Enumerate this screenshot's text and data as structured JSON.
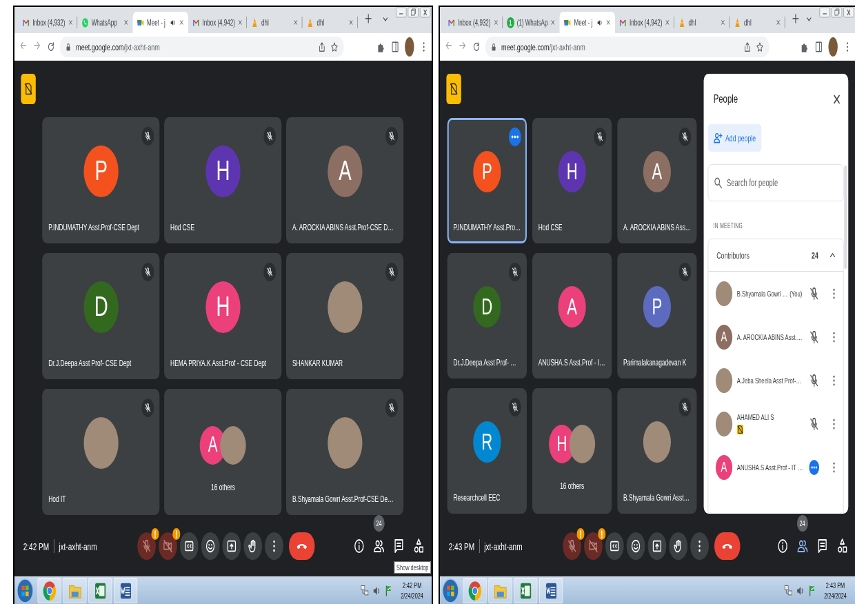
{
  "screens": [
    {
      "browser": {
        "tabs": [
          {
            "kind": "gmail",
            "label": "Inbox (4,932)",
            "selected": false,
            "audio": false
          },
          {
            "kind": "whatsapp",
            "label": "WhatsApp",
            "selected": false,
            "audio": false
          },
          {
            "kind": "meet",
            "label": "Meet - j",
            "selected": true,
            "audio": true
          },
          {
            "kind": "gmail",
            "label": "Inbox (4,942)",
            "selected": false,
            "audio": false
          },
          {
            "kind": "cone",
            "label": "dhl",
            "selected": false,
            "audio": false
          },
          {
            "kind": "cone",
            "label": "dhl",
            "selected": false,
            "audio": false
          }
        ],
        "url_host": "meet.google.com",
        "url_path": "/jxt-axht-anm"
      },
      "meet": {
        "tiles": [
          {
            "kind": "person",
            "name": "P.INDUMATHY Asst.Prof-CSE Dept",
            "avatar": {
              "kind": "initial",
              "initial": "P",
              "color": "#f4511e"
            },
            "muted": true,
            "talking": false,
            "highlighted": false
          },
          {
            "kind": "person",
            "name": "Hod CSE",
            "avatar": {
              "kind": "initial",
              "initial": "H",
              "color": "#5e35b1"
            },
            "muted": true,
            "talking": false,
            "highlighted": false
          },
          {
            "kind": "person",
            "name": "A. AROCKIA ABINS Asst.Prof-CSE D…",
            "avatar": {
              "kind": "initial",
              "initial": "A",
              "color": "#8d6e63"
            },
            "muted": true,
            "talking": false,
            "highlighted": false
          },
          {
            "kind": "person",
            "name": "Dr.J.Deepa Asst Prof- CSE Dept",
            "avatar": {
              "kind": "initial",
              "initial": "D",
              "color": "#33691e"
            },
            "muted": true,
            "talking": false,
            "highlighted": false
          },
          {
            "kind": "person",
            "name": "HEMA PRIYA.K Asst.Prof - CSE Dept",
            "avatar": {
              "kind": "initial",
              "initial": "H",
              "color": "#ec407a"
            },
            "muted": true,
            "talking": false,
            "highlighted": false
          },
          {
            "kind": "person",
            "name": "SHANKAR KUMAR",
            "avatar": {
              "kind": "photo"
            },
            "muted": true,
            "talking": false,
            "highlighted": false
          },
          {
            "kind": "person",
            "name": "Hod IT",
            "avatar": {
              "kind": "photo"
            },
            "muted": true,
            "talking": false,
            "highlighted": false
          },
          {
            "kind": "group",
            "avatars": [
              {
                "kind": "initial",
                "initial": "A",
                "color": "#ec407a"
              },
              {
                "kind": "photo"
              }
            ],
            "others": "16 others",
            "muted": false,
            "talking": false,
            "highlighted": false
          },
          {
            "kind": "person",
            "name": "B.Shyamala Gowri Asst.Prof-CSE De…",
            "avatar": {
              "kind": "photo"
            },
            "muted": true,
            "talking": false,
            "highlighted": false
          }
        ],
        "time": "2:42 PM",
        "code": "jxt-axht-anm",
        "controls": [
          {
            "kind": "mic",
            "off": true,
            "alert": true
          },
          {
            "kind": "camera",
            "off": true,
            "alert": true
          },
          {
            "kind": "captions",
            "off": false,
            "alert": false
          },
          {
            "kind": "emoji",
            "off": false,
            "alert": false
          },
          {
            "kind": "present",
            "off": false,
            "alert": false
          },
          {
            "kind": "hand",
            "off": false,
            "alert": false
          },
          {
            "kind": "more",
            "off": false,
            "alert": false
          },
          {
            "kind": "leave",
            "off": false,
            "alert": false
          }
        ],
        "side": [
          {
            "kind": "info",
            "selected": false
          },
          {
            "kind": "people",
            "selected": false,
            "badge": "24"
          },
          {
            "kind": "chat",
            "selected": false
          },
          {
            "kind": "activities",
            "selected": false
          }
        ],
        "tooltip": "Show desktop"
      },
      "taskbar": {
        "time": "2:42 PM",
        "date": "2/24/2024"
      }
    },
    {
      "browser": {
        "tabs": [
          {
            "kind": "gmail",
            "label": "Inbox (4,932)",
            "selected": false,
            "audio": false
          },
          {
            "kind": "whatsapp",
            "label": "(1) WhatsAp",
            "selected": false,
            "audio": false,
            "icon_badge": "1"
          },
          {
            "kind": "meet",
            "label": "Meet - j",
            "selected": true,
            "audio": true
          },
          {
            "kind": "gmail",
            "label": "Inbox (4,942)",
            "selected": false,
            "audio": false
          },
          {
            "kind": "cone",
            "label": "dhl",
            "selected": false,
            "audio": false
          },
          {
            "kind": "cone",
            "label": "dhl",
            "selected": false,
            "audio": false
          }
        ],
        "url_host": "meet.google.com",
        "url_path": "/jxt-axht-anm"
      },
      "meet": {
        "tiles": [
          {
            "kind": "person",
            "name": "P.INDUMATHY Asst.Pro…",
            "avatar": {
              "kind": "initial",
              "initial": "P",
              "color": "#f4511e"
            },
            "muted": false,
            "talking": true,
            "highlighted": true
          },
          {
            "kind": "person",
            "name": "Hod CSE",
            "avatar": {
              "kind": "initial",
              "initial": "H",
              "color": "#5e35b1"
            },
            "muted": true,
            "talking": false,
            "highlighted": false
          },
          {
            "kind": "person",
            "name": "A. AROCKIA ABINS Ass…",
            "avatar": {
              "kind": "initial",
              "initial": "A",
              "color": "#8d6e63"
            },
            "muted": true,
            "talking": false,
            "highlighted": false
          },
          {
            "kind": "person",
            "name": "Dr.J.Deepa Asst Prof- …",
            "avatar": {
              "kind": "initial",
              "initial": "D",
              "color": "#33691e"
            },
            "muted": true,
            "talking": false,
            "highlighted": false
          },
          {
            "kind": "person",
            "name": "ANUSHA.S Asst.Prof - I…",
            "avatar": {
              "kind": "initial",
              "initial": "A",
              "color": "#ec407a"
            },
            "muted": false,
            "talking": false,
            "highlighted": false
          },
          {
            "kind": "person",
            "name": "Parimalakanagadevan K",
            "avatar": {
              "kind": "initial",
              "initial": "P",
              "color": "#5c6bc0"
            },
            "muted": true,
            "talking": false,
            "highlighted": false
          },
          {
            "kind": "person",
            "name": "Researchcell EEC",
            "avatar": {
              "kind": "initial",
              "initial": "R",
              "color": "#0288d1"
            },
            "muted": true,
            "talking": false,
            "highlighted": false
          },
          {
            "kind": "group",
            "avatars": [
              {
                "kind": "initial",
                "initial": "H",
                "color": "#ec407a"
              },
              {
                "kind": "photo"
              }
            ],
            "others": "16 others",
            "muted": false,
            "talking": false,
            "highlighted": false
          },
          {
            "kind": "person",
            "name": "B.Shyamala Gowri Asst…",
            "avatar": {
              "kind": "photo"
            },
            "muted": true,
            "talking": false,
            "highlighted": false
          }
        ],
        "people": {
          "title": "People",
          "add_label": "Add people",
          "search_placeholder": "Search for people",
          "section": "IN MEETING",
          "group": {
            "label": "Contributors",
            "count": "24",
            "expanded": true,
            "rows": [
              {
                "name": "B.Shyamala Gowri …",
                "you": "(You)",
                "avatar": {
                  "kind": "photo"
                },
                "muted": true,
                "talking": false,
                "presenting": false
              },
              {
                "name": "A. AROCKIA ABINS Asst.…",
                "avatar": {
                  "kind": "initial",
                  "initial": "A",
                  "color": "#8d6e63"
                },
                "muted": true,
                "talking": false,
                "presenting": false
              },
              {
                "name": "A.Jeba Sheela Asst Prof-…",
                "avatar": {
                  "kind": "photo"
                },
                "muted": true,
                "talking": false,
                "presenting": false
              },
              {
                "name": "AHAMED ALI S",
                "avatar": {
                  "kind": "photo"
                },
                "muted": true,
                "talking": false,
                "presenting": true
              },
              {
                "name": "ANUSHA.S Asst.Prof - IT …",
                "avatar": {
                  "kind": "initial",
                  "initial": "A",
                  "color": "#ec407a"
                },
                "muted": false,
                "talking": true,
                "presenting": false
              }
            ]
          }
        },
        "time": "2:43 PM",
        "code": "jxt-axht-anm",
        "controls": [
          {
            "kind": "mic",
            "off": true,
            "alert": true
          },
          {
            "kind": "camera",
            "off": true,
            "alert": true
          },
          {
            "kind": "captions",
            "off": false,
            "alert": false
          },
          {
            "kind": "emoji",
            "off": false,
            "alert": false
          },
          {
            "kind": "present",
            "off": false,
            "alert": false
          },
          {
            "kind": "hand",
            "off": false,
            "alert": false
          },
          {
            "kind": "more",
            "off": false,
            "alert": false
          },
          {
            "kind": "leave",
            "off": false,
            "alert": false
          }
        ],
        "side": [
          {
            "kind": "info",
            "selected": false
          },
          {
            "kind": "people",
            "selected": true,
            "badge": "24"
          },
          {
            "kind": "chat",
            "selected": false
          },
          {
            "kind": "activities",
            "selected": false
          }
        ]
      },
      "taskbar": {
        "time": "2:43 PM",
        "date": "2/24/2024"
      }
    }
  ]
}
